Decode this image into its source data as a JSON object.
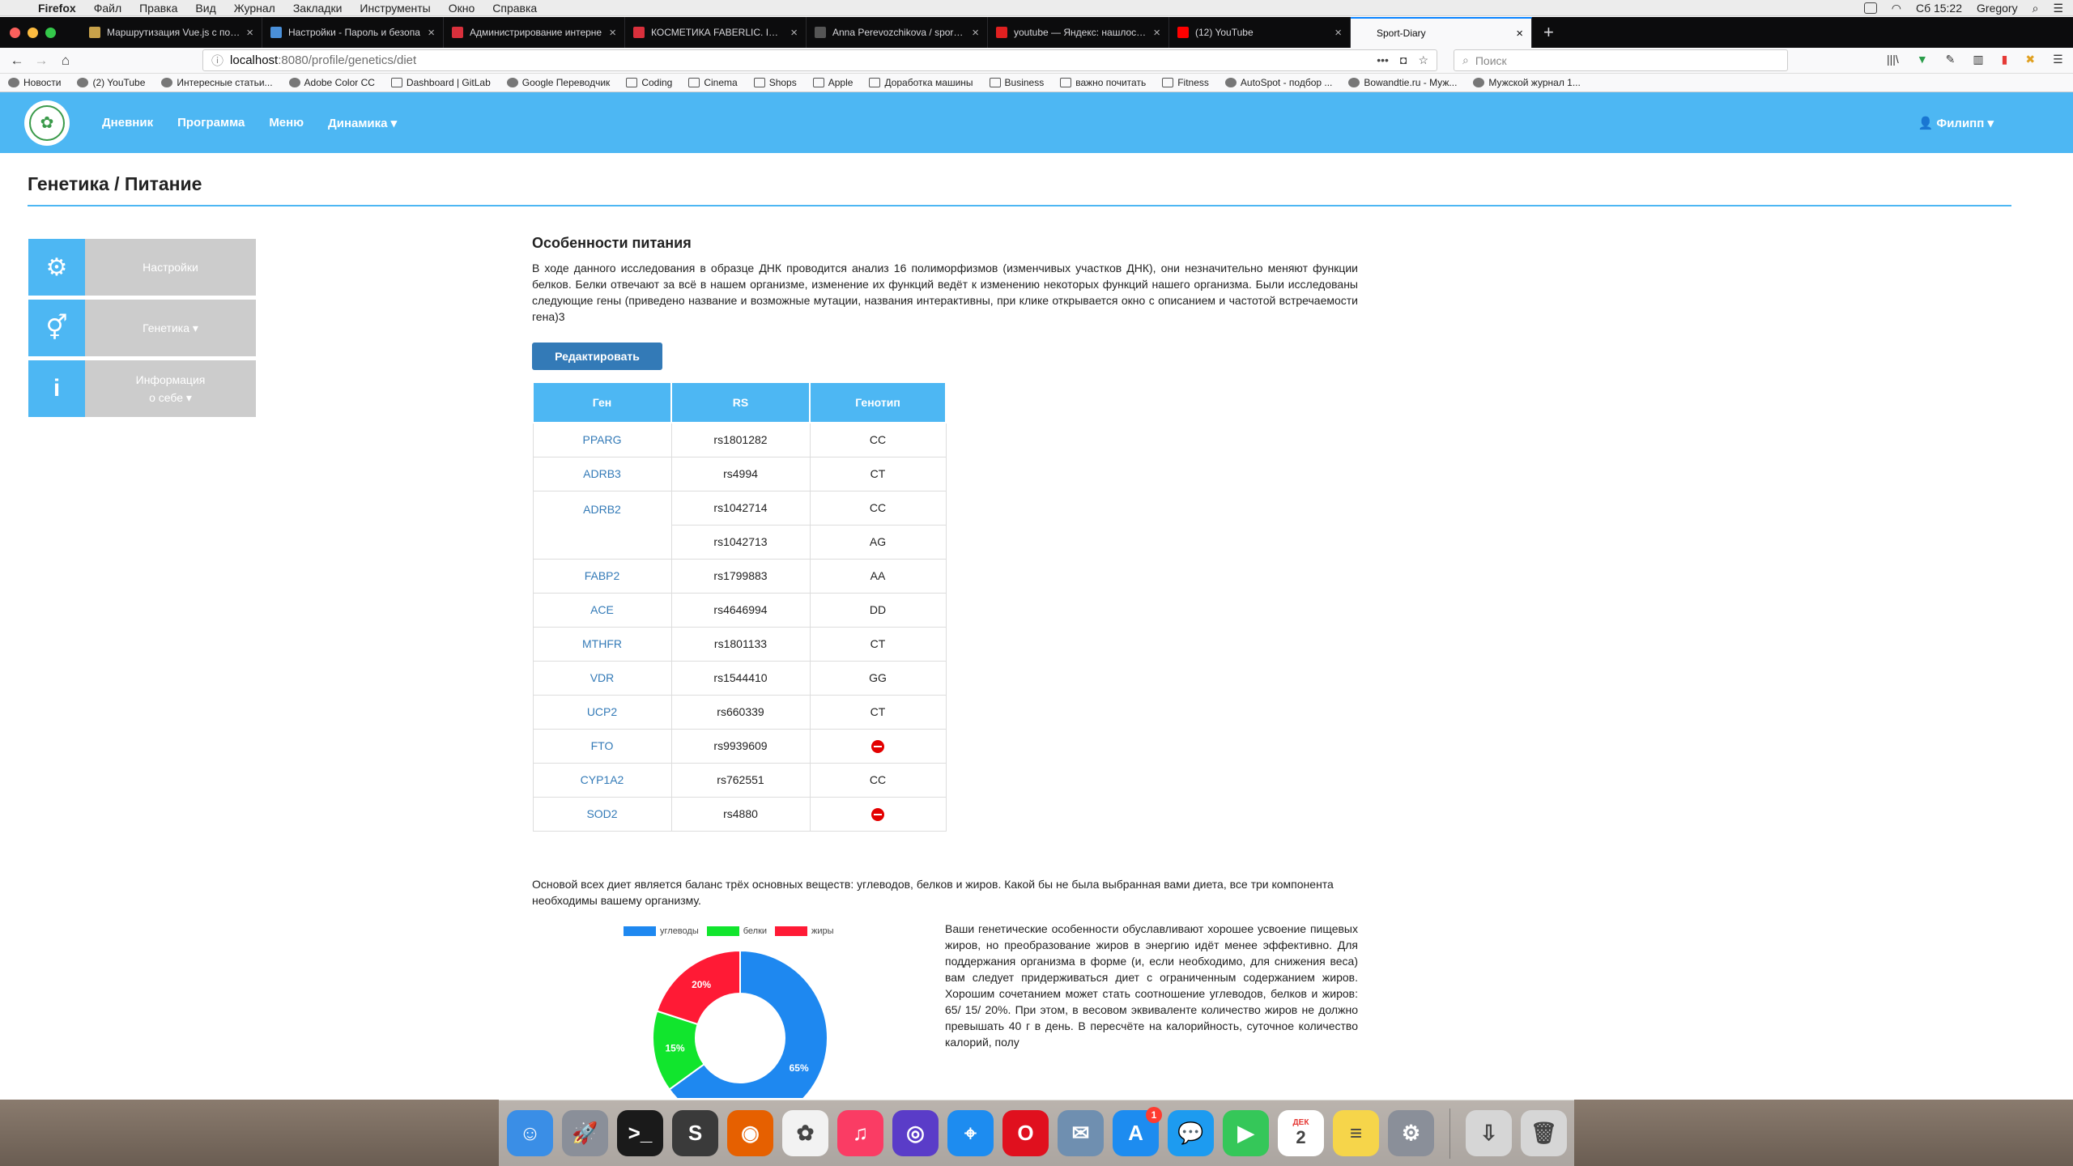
{
  "menubar": {
    "app": "Firefox",
    "items": [
      "Файл",
      "Правка",
      "Вид",
      "Журнал",
      "Закладки",
      "Инструменты",
      "Окно",
      "Справка"
    ],
    "clock": "Сб 15:22",
    "user": "Gregory"
  },
  "tabs": [
    {
      "title": "Маршрутизация Vue.js с помо",
      "color": "#c8a24a"
    },
    {
      "title": "Настройки - Пароль и безопа",
      "color": "#4a90d9"
    },
    {
      "title": "Администрирование интерне",
      "color": "#d9303c"
    },
    {
      "title": "КОСМЕТИКА FABERLIC. INFINI",
      "color": "#d9303c"
    },
    {
      "title": "Anna Perevozchikova / sport-di",
      "color": "#555555"
    },
    {
      "title": "youtube — Яндекс: нашлось 6",
      "color": "#e02020"
    },
    {
      "title": "(12) YouTube",
      "color": "#ff0000"
    },
    {
      "title": "Sport-Diary",
      "color": "#ffffff"
    }
  ],
  "url": {
    "host": "localhost",
    "path": ":8080/profile/genetics/diet"
  },
  "search_placeholder": "Поиск",
  "bookmarks": [
    {
      "label": "Новости",
      "kind": "site"
    },
    {
      "label": "(2) YouTube",
      "kind": "site"
    },
    {
      "label": "Интересные статьи...",
      "kind": "site"
    },
    {
      "label": "Adobe Color CC",
      "kind": "site"
    },
    {
      "label": "Dashboard | GitLab",
      "kind": "folder"
    },
    {
      "label": "Google Переводчик",
      "kind": "site"
    },
    {
      "label": "Coding",
      "kind": "folder"
    },
    {
      "label": "Cinema",
      "kind": "folder"
    },
    {
      "label": "Shops",
      "kind": "folder"
    },
    {
      "label": "Apple",
      "kind": "folder"
    },
    {
      "label": "Доработка машины",
      "kind": "folder"
    },
    {
      "label": "Business",
      "kind": "folder"
    },
    {
      "label": "важно почитать",
      "kind": "folder"
    },
    {
      "label": "Fitness",
      "kind": "folder"
    },
    {
      "label": "AutoSpot - подбор ...",
      "kind": "site"
    },
    {
      "label": "Bowandtie.ru - Муж...",
      "kind": "site"
    },
    {
      "label": "Мужской журнал 1...",
      "kind": "site"
    }
  ],
  "header": {
    "nav": [
      "Дневник",
      "Программа",
      "Меню",
      "Динамика ▾"
    ],
    "user": "👤 Филипп ▾"
  },
  "page_title": "Генетика / Питание",
  "sidebar": [
    {
      "label": "Настройки",
      "icon": "gear-icon"
    },
    {
      "label": "Генетика ▾",
      "icon": "gender-icon"
    },
    {
      "label": "Информация\nо себе ▾",
      "icon": "info-icon"
    }
  ],
  "section": {
    "title": "Особенности питания",
    "intro": "В ходе данного исследования в образце ДНК проводится анализ 16 полиморфизмов (изменчивых участков ДНК), они незначительно меняют функции белков. Белки отвечают за всё в нашем организме, изменение их функций ведёт к изменению некоторых функций нашего организма. Были исследованы следующие гены (приведено название и возможные мутации, названия интерактивны, при клике открывается окно с описанием и частотой встречаемости гена)3",
    "edit_button": "Редактировать"
  },
  "table": {
    "headers": [
      "Ген",
      "RS",
      "Генотип"
    ],
    "rows": [
      {
        "gene": "PPARG",
        "rs": "rs1801282",
        "genotype": "CC"
      },
      {
        "gene": "ADRB3",
        "rs": "rs4994",
        "genotype": "CT"
      },
      {
        "gene": "ADRB2",
        "rs": "rs1042714",
        "genotype": "CC"
      },
      {
        "gene": "",
        "rs": "rs1042713",
        "genotype": "AG"
      },
      {
        "gene": "FABP2",
        "rs": "rs1799883",
        "genotype": "AA"
      },
      {
        "gene": "ACE",
        "rs": "rs4646994",
        "genotype": "DD"
      },
      {
        "gene": "MTHFR",
        "rs": "rs1801133",
        "genotype": "CT"
      },
      {
        "gene": "VDR",
        "rs": "rs1544410",
        "genotype": "GG"
      },
      {
        "gene": "UCP2",
        "rs": "rs660339",
        "genotype": "CT"
      },
      {
        "gene": "FTO",
        "rs": "rs9939609",
        "genotype": ""
      },
      {
        "gene": "CYP1A2",
        "rs": "rs762551",
        "genotype": "CC"
      },
      {
        "gene": "SOD2",
        "rs": "rs4880",
        "genotype": ""
      }
    ]
  },
  "balance_text": "Основой всех диет является баланс трёх основных веществ: углеводов, белков и жиров. Какой бы не была выбранная вами диета, все три компонента необходимы вашему организму.",
  "chart_data": {
    "type": "pie",
    "categories": [
      "углеводы",
      "белки",
      "жиры"
    ],
    "values": [
      65,
      15,
      20
    ],
    "labels": [
      "65%",
      "15%",
      "20%"
    ],
    "colors": [
      "#1e88f0",
      "#11e52d",
      "#ff1a35"
    ],
    "legend": "top"
  },
  "advice_text": "Ваши генетические особенности обуславливают хорошее усвоение пищевых жиров, но преобразование жиров в энергию идёт менее эффективно. Для поддержания организма в форме (и, если необходимо, для снижения веса) вам следует придерживаться диет с ограниченным содержанием жиров. Хорошим сочетанием может стать соотношение углеводов, белков и жиров: 65/ 15/ 20%. При этом, в весовом эквиваленте количество жиров не должно превышать 40 г в день. В пересчёте на калорийность, суточное количество калорий, полу",
  "dock": [
    {
      "name": "finder",
      "color": "#3a8ee6",
      "glyph": "☺"
    },
    {
      "name": "launchpad",
      "color": "#8a8f99",
      "glyph": "🚀"
    },
    {
      "name": "terminal",
      "color": "#1a1a1a",
      "glyph": ">_"
    },
    {
      "name": "sublime",
      "color": "#3a3a3a",
      "glyph": "S"
    },
    {
      "name": "firefox",
      "color": "#e66000",
      "glyph": "◉"
    },
    {
      "name": "photos",
      "color": "#f2f2f2",
      "glyph": "✿"
    },
    {
      "name": "music",
      "color": "#fa3c64",
      "glyph": "♫"
    },
    {
      "name": "siri",
      "color": "#5a3cc8",
      "glyph": "◎"
    },
    {
      "name": "safari",
      "color": "#1d8cf0",
      "glyph": "⌖"
    },
    {
      "name": "opera",
      "color": "#e0101e",
      "glyph": "O"
    },
    {
      "name": "preview",
      "color": "#6f8fb0",
      "glyph": "✉"
    },
    {
      "name": "appstore",
      "color": "#1d8cf0",
      "glyph": "A",
      "badge": "1"
    },
    {
      "name": "messages",
      "color": "#1d9bf0",
      "glyph": "💬"
    },
    {
      "name": "facetime",
      "color": "#35c759",
      "glyph": "▶"
    },
    {
      "name": "calendar",
      "color": "#ffffff",
      "glyph": "2",
      "month": "ДЕК"
    },
    {
      "name": "notes",
      "color": "#f6d54a",
      "glyph": "≡"
    },
    {
      "name": "settings",
      "color": "#8a8f99",
      "glyph": "⚙"
    },
    {
      "name": "downloads",
      "color": "#d6d6d6",
      "glyph": "⇩"
    },
    {
      "name": "trash",
      "color": "#d6d6d6",
      "glyph": "🗑"
    }
  ]
}
